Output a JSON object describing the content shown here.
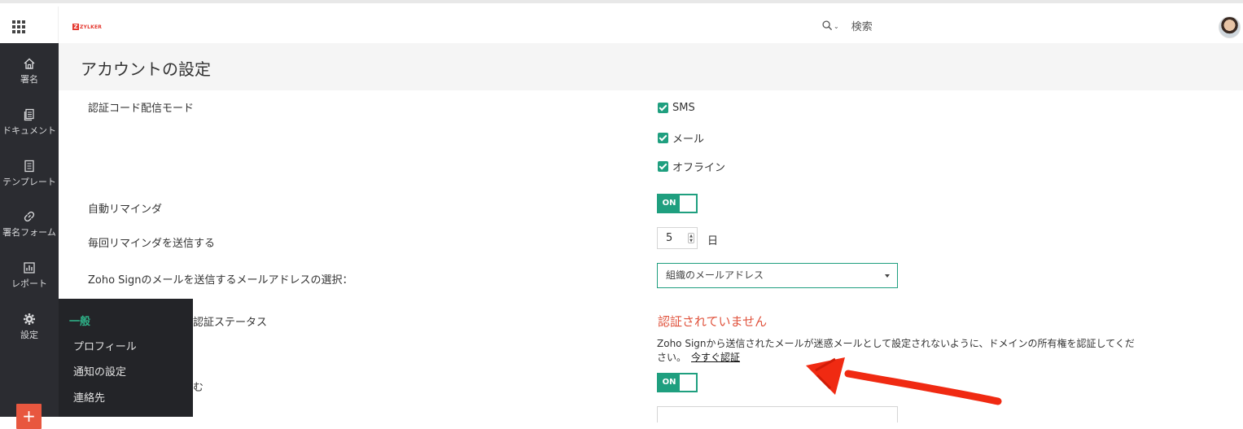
{
  "header": {
    "logo_text": "ZYLKER",
    "search_label": "検索"
  },
  "sidebar": {
    "items": [
      {
        "label": "署名",
        "icon": "home-icon"
      },
      {
        "label": "ドキュメント",
        "icon": "document-icon"
      },
      {
        "label": "テンプレート",
        "icon": "template-icon"
      },
      {
        "label": "署名フォーム",
        "icon": "link-icon"
      },
      {
        "label": "レポート",
        "icon": "report-icon"
      },
      {
        "label": "設定",
        "icon": "gear-icon"
      }
    ],
    "add_label": "+"
  },
  "submenu": {
    "heading": "一般",
    "items": [
      "プロフィール",
      "通知の設定",
      "連絡先"
    ]
  },
  "page": {
    "title": "アカウントの設定"
  },
  "settings": {
    "otp_mode_label": "認証コード配信モード",
    "otp_options": [
      "SMS",
      "メール",
      "オフライン"
    ],
    "auto_reminder_label": "自動リマインダ",
    "auto_reminder_toggle": "ON",
    "reminder_interval_label": "毎回リマインダを送信する",
    "reminder_interval_value": "5",
    "reminder_interval_unit": "日",
    "sender_email_label": "Zoho Signのメールを送信するメールアドレスの選択：",
    "sender_email_value": "組織のメールアドレス",
    "domain_status_label": "認証ステータス",
    "domain_status_value": "認証されていません",
    "domain_description": "Zoho Signから送信されたメールが迷惑メールとして設定されないように、ドメインの所有権を認証してください。",
    "verify_now_link": "今すぐ認証",
    "include_label_partial": "む",
    "include_toggle": "ON"
  },
  "colors": {
    "accent": "#1f9f7f",
    "warning": "#e0533d",
    "sidebar_bg": "#2b2c31"
  }
}
